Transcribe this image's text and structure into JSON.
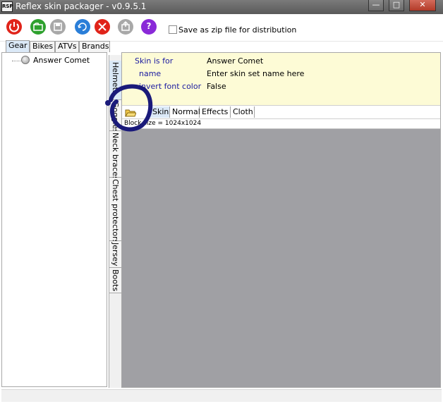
{
  "window": {
    "title": "Reflex skin packager - v0.9.5.1",
    "icon_label": "RSP",
    "controls": {
      "minimize": "—",
      "maximize": "□",
      "close": "✕"
    }
  },
  "toolbar": {
    "buttons": [
      {
        "name": "power-icon",
        "color": "#e0241a"
      },
      {
        "name": "open-folder-icon",
        "color": "#2ea12e"
      },
      {
        "name": "save-icon",
        "color": "#a0a0a0"
      },
      {
        "name": "import-icon",
        "color": "#2a7ed8"
      },
      {
        "name": "delete-icon",
        "color": "#e0241a"
      },
      {
        "name": "export-icon",
        "color": "#a0a0a0"
      },
      {
        "name": "help-icon",
        "color": "#8a2ad8",
        "glyph": "?"
      }
    ],
    "zip_checkbox": {
      "checked": false,
      "label": "Save as zip file for distribution"
    }
  },
  "top_tabs": [
    {
      "label": "Gear",
      "active": true
    },
    {
      "label": "Bikes",
      "active": false
    },
    {
      "label": "ATVs",
      "active": false
    },
    {
      "label": "Brands",
      "active": false
    }
  ],
  "tree": {
    "items": [
      {
        "label": "Answer Comet"
      }
    ]
  },
  "vertical_tabs": [
    {
      "label": "Helmets",
      "active": true
    },
    {
      "label": "Goggles",
      "active": false
    },
    {
      "label": "Neck braces",
      "active": false
    },
    {
      "label": "Chest protectors",
      "active": false
    },
    {
      "label": "Jersey",
      "active": false
    },
    {
      "label": "Boots",
      "active": false
    }
  ],
  "properties": [
    {
      "key": "Skin is for",
      "value": "Answer Comet"
    },
    {
      "key": "name",
      "value": "Enter skin set name here"
    },
    {
      "key": "invert font color",
      "value": "False"
    }
  ],
  "sub_tabs": [
    {
      "label": "Skin",
      "active": true
    },
    {
      "label": "Normal",
      "active": false
    },
    {
      "label": "Effects",
      "active": false
    },
    {
      "label": "Cloth",
      "active": false
    }
  ],
  "block_size": "Block size = 1024x1024",
  "colors": {
    "annotation": "#1a1a7a",
    "property_background": "#fdfbd6",
    "canvas_background": "#a0a0a4"
  }
}
